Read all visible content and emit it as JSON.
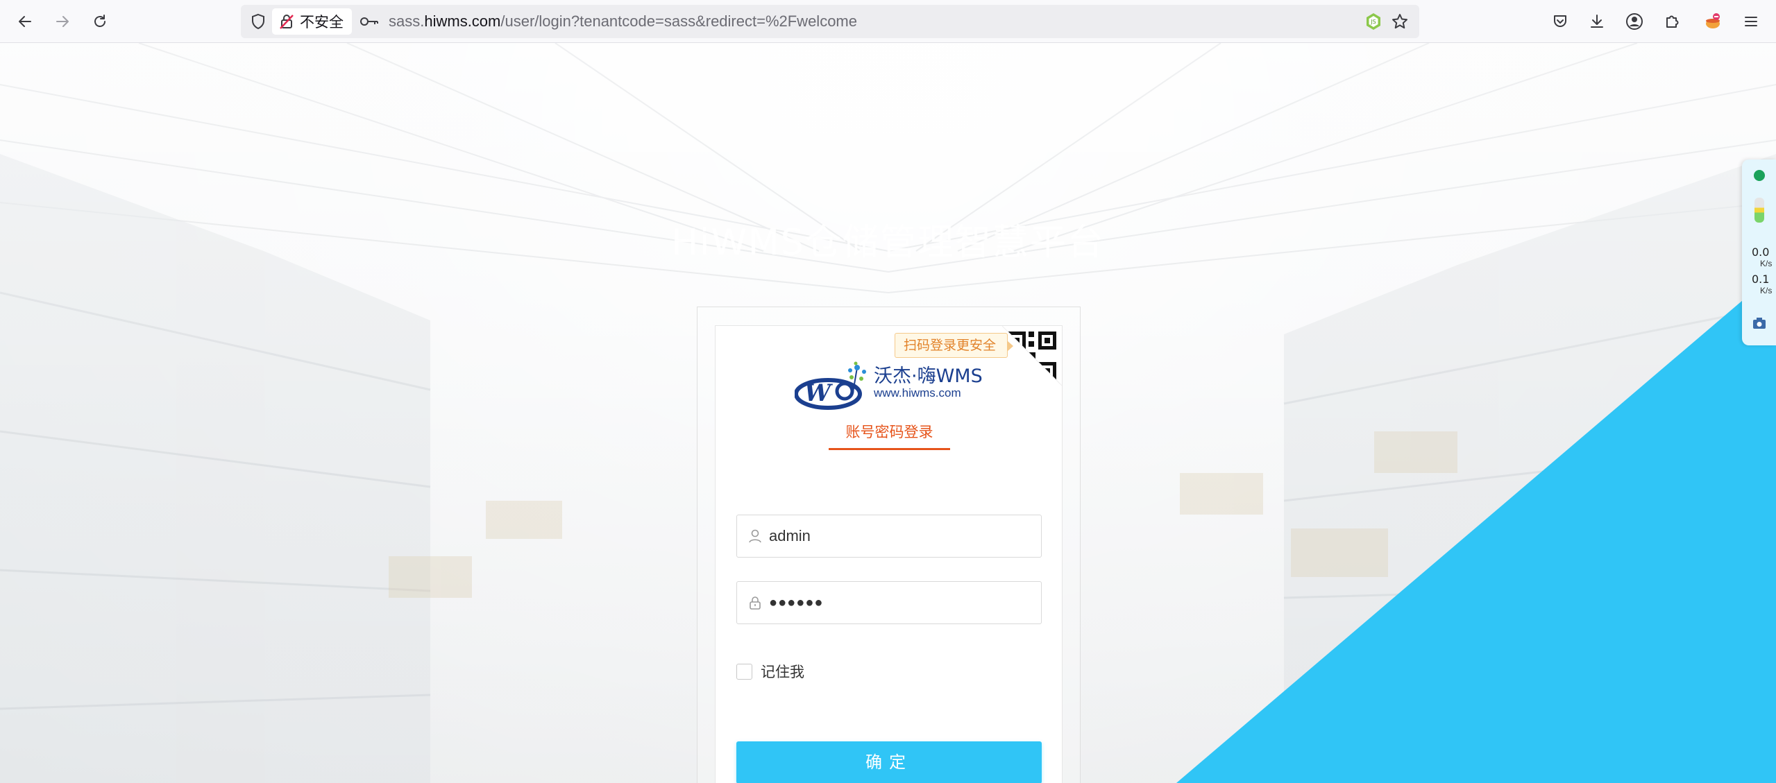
{
  "browser": {
    "url_prefix": "sass.",
    "url_host": "hiwms.com",
    "url_path": "/user/login?tenantcode=sass&redirect=%2Fwelcome",
    "security_label": "不安全"
  },
  "page": {
    "platform_title": "HiWMS仓储管理智慧平台"
  },
  "login": {
    "scan_tip": "扫码登录更安全",
    "logo_cn": "沃杰·嗨WMS",
    "logo_url": "www.hiwms.com",
    "tab_label": "账号密码登录",
    "username_value": "admin",
    "password_value": "●●●●●●",
    "remember_label": "记住我",
    "submit_label": "确定"
  },
  "speed_widget": {
    "upload_value": "0.0",
    "upload_unit": "K/s",
    "download_value": "0.1",
    "download_unit": "K/s"
  },
  "colors": {
    "accent_blue": "#30c5f6",
    "tab_orange": "#e6541b",
    "logo_navy": "#1b3f8f"
  }
}
